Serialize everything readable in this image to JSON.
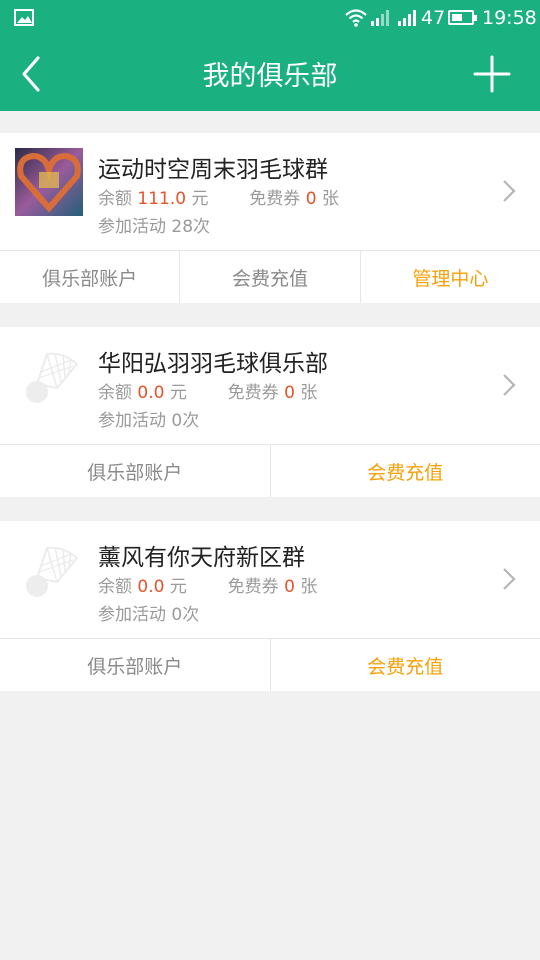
{
  "status_bar": {
    "battery_level": "47",
    "time": "19:58"
  },
  "nav": {
    "title": "我的俱乐部",
    "back_icon": "chevron-left-icon",
    "add_icon": "plus-icon"
  },
  "labels": {
    "balance": "余额",
    "currency": "元",
    "voucher": "免费券",
    "voucher_unit": "张"
  },
  "colors": {
    "header": "#1ab07f",
    "amount": "#e8522a",
    "action_accent": "#f5a10a"
  },
  "clubs": [
    {
      "name": "运动时空周末羽毛球群",
      "balance": "111.0",
      "vouchers": "0",
      "activity": "参加活动 28次",
      "actions": [
        "俱乐部账户",
        "会费充值",
        "管理中心"
      ]
    },
    {
      "name": "华阳弘羽羽毛球俱乐部",
      "balance": "0.0",
      "vouchers": "0",
      "activity": "参加活动 0次",
      "actions": [
        "俱乐部账户",
        "会费充值"
      ]
    },
    {
      "name": "薰风有你天府新区群",
      "balance": "0.0",
      "vouchers": "0",
      "activity": "参加活动 0次",
      "actions": [
        "俱乐部账户",
        "会费充值"
      ]
    }
  ]
}
